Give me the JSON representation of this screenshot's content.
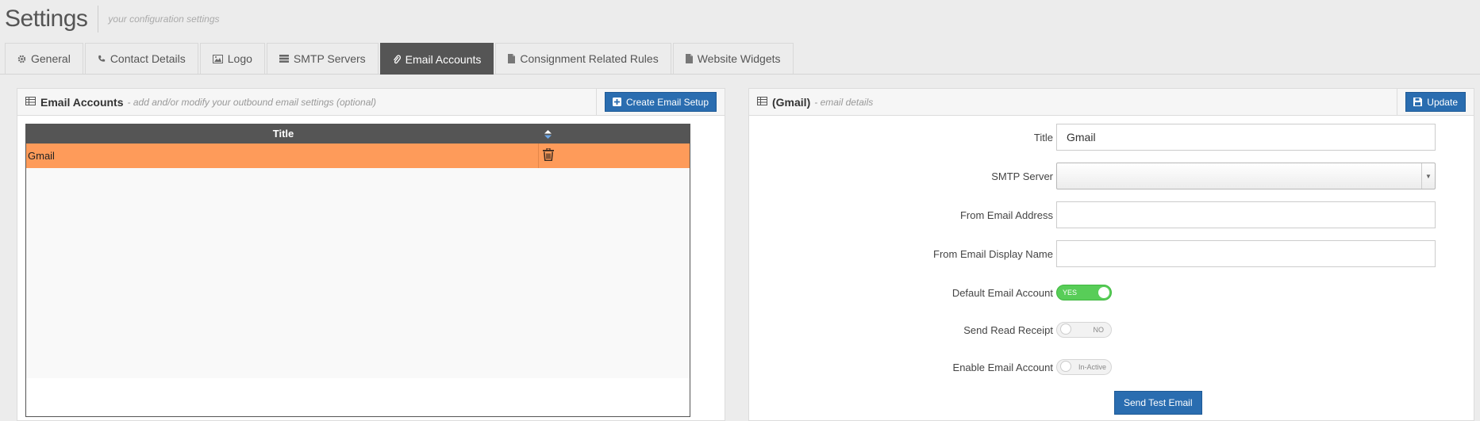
{
  "header": {
    "title": "Settings",
    "subtitle": "your configuration settings"
  },
  "tabs": [
    {
      "label": "General",
      "icon": "gear-icon"
    },
    {
      "label": "Contact Details",
      "icon": "phone-icon"
    },
    {
      "label": "Logo",
      "icon": "image-icon"
    },
    {
      "label": "SMTP Servers",
      "icon": "server-icon"
    },
    {
      "label": "Email Accounts",
      "icon": "paperclip-icon",
      "active": true
    },
    {
      "label": "Consignment Related Rules",
      "icon": "file-icon"
    },
    {
      "label": "Website Widgets",
      "icon": "file-icon"
    }
  ],
  "left_panel": {
    "title": "Email Accounts",
    "subtitle": "- add and/or modify your outbound email settings (optional)",
    "create_button": "Create Email Setup",
    "grid": {
      "column_title": "Title",
      "rows": [
        {
          "title": "Gmail"
        }
      ]
    }
  },
  "right_panel": {
    "title": "(Gmail)",
    "subtitle": "- email details",
    "update_button": "Update",
    "fields": {
      "title_label": "Title",
      "title_value": "Gmail",
      "smtp_label": "SMTP Server",
      "smtp_value": "",
      "from_address_label": "From Email Address",
      "from_address_value": "",
      "from_name_label": "From Email Display Name",
      "from_name_value": "",
      "default_label": "Default Email Account",
      "default_toggle": "YES",
      "read_receipt_label": "Send Read Receipt",
      "read_receipt_toggle": "NO",
      "enable_label": "Enable Email Account",
      "enable_toggle": "In-Active"
    },
    "send_test_button": "Send Test Email"
  },
  "colors": {
    "active_tab": "#555555",
    "primary_button": "#2a6db0",
    "selected_row": "#fe9b5a",
    "toggle_on": "#58cd58"
  }
}
